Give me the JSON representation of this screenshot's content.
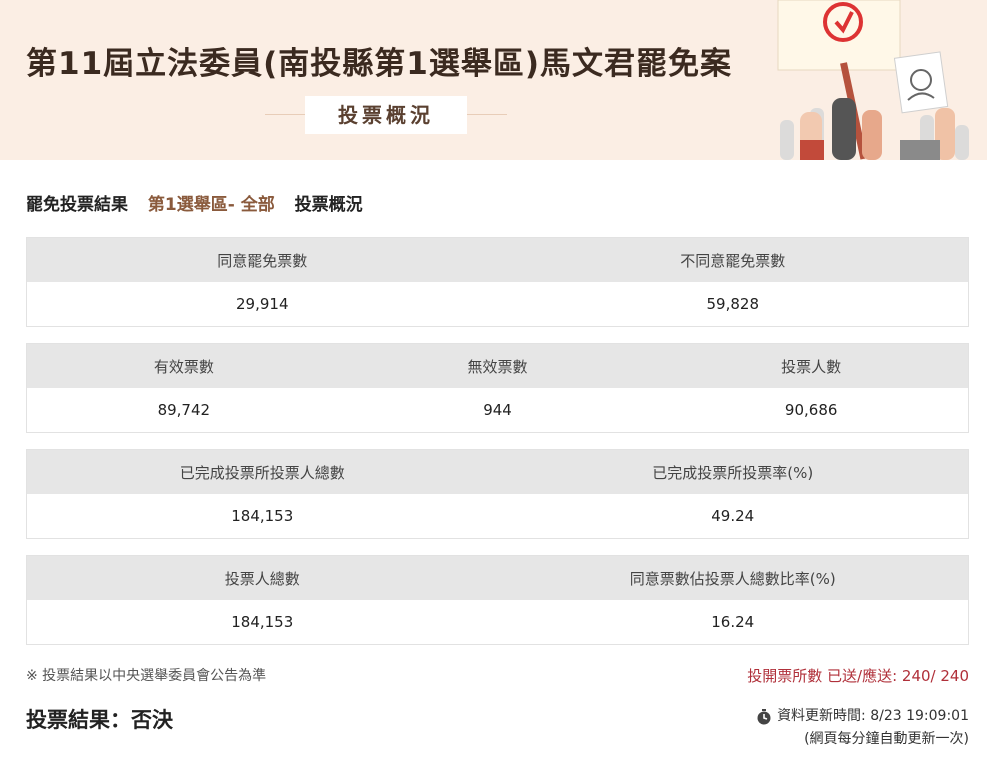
{
  "banner": {
    "title": "第11屆立法委員(南投縣第1選舉區)馬文君罷免案",
    "subtitle": "投票概況"
  },
  "breadcrumb": {
    "item1": "罷免投票結果",
    "item2": "第1選舉區- 全部",
    "item3": "投票概況"
  },
  "table1": {
    "headers": [
      "同意罷免票數",
      "不同意罷免票數"
    ],
    "values": [
      "29,914",
      "59,828"
    ]
  },
  "table2": {
    "headers": [
      "有效票數",
      "無效票數",
      "投票人數"
    ],
    "values": [
      "89,742",
      "944",
      "90,686"
    ]
  },
  "table3": {
    "headers": [
      "已完成投票所投票人總數",
      "已完成投票所投票率(%)"
    ],
    "values": [
      "184,153",
      "49.24"
    ]
  },
  "table4": {
    "headers": [
      "投票人總數",
      "同意票數佔投票人總數比率(%)"
    ],
    "values": [
      "184,153",
      "16.24"
    ]
  },
  "footer": {
    "note": "※ 投票結果以中央選舉委員會公告為準",
    "station_count": "投開票所數 已送/應送: 240/ 240",
    "result": "投票結果：否決",
    "update_time": "資料更新時間: 8/23 19:09:01",
    "refresh_note": "(網頁每分鐘自動更新一次)"
  },
  "colors": {
    "banner_bg": "#fbeee4",
    "accent_brown": "#8a5a3c",
    "accent_red": "#b0303a"
  }
}
